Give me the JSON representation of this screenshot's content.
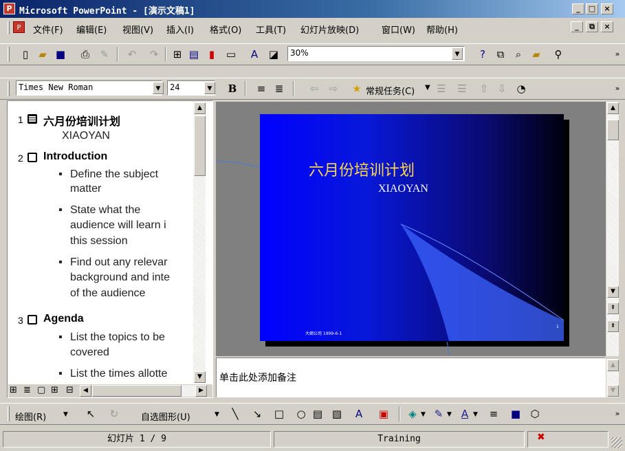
{
  "window": {
    "title": "Microsoft PowerPoint - [演示文稿1]",
    "caption_buttons": [
      "_",
      "□",
      "×"
    ]
  },
  "menu": {
    "items": [
      "文件(F)",
      "编辑(E)",
      "视图(V)",
      "插入(I)",
      "格式(O)",
      "工具(T)",
      "幻灯片放映(D)",
      "窗口(W)",
      "帮助(H)"
    ],
    "doc_buttons": [
      "_",
      "⧉",
      "×"
    ]
  },
  "standard_toolbar": {
    "zoom_value": "30%",
    "icons": [
      "new-icon",
      "open-icon",
      "save-icon",
      "print-icon",
      "format-painter-icon",
      "undo-icon",
      "redo-icon",
      "insert-table-icon",
      "table-icon",
      "chart-icon",
      "new-slide-icon",
      "text-color-icon",
      "expand-icon",
      "help-icon",
      "slide-sorter-icon",
      "zoom-icon",
      "open-folder-icon",
      "find-icon"
    ]
  },
  "formatting_toolbar": {
    "font_name": "Times New Roman",
    "font_size": "24",
    "bold_label": "B",
    "common_tasks_label": "常规任务(C)"
  },
  "outline": {
    "slides": [
      {
        "number": "1",
        "title": "六月份培训计划",
        "lines": [
          "XIAOYAN"
        ]
      },
      {
        "number": "2",
        "title": "Introduction",
        "bullets": [
          [
            "Define the subject",
            "matter"
          ],
          [
            "State what the",
            "audience will learn i",
            "this session"
          ],
          [
            "Find out any relevar",
            "background and inte",
            "of the audience"
          ]
        ]
      },
      {
        "number": "3",
        "title": "Agenda",
        "bullets": [
          [
            "List the topics to be",
            "covered"
          ],
          [
            "List the times allotte"
          ]
        ]
      }
    ]
  },
  "slide": {
    "title": "六月份培训计划",
    "subtitle": "XIAOYAN",
    "footer": "大纲公司 1999-6-1",
    "page_marker": "1",
    "colors": {
      "title": "#ffd84a",
      "subtitle": "#ffffff",
      "bg_start": "#0000ff",
      "bg_end": "#000010"
    }
  },
  "notes": {
    "placeholder": "单击此处添加备注"
  },
  "drawing_toolbar": {
    "draw_label": "绘图(R)",
    "autoshapes_label": "自选图形(U)"
  },
  "status": {
    "slide_position": "幻灯片 1 / 9",
    "design": "Training"
  }
}
